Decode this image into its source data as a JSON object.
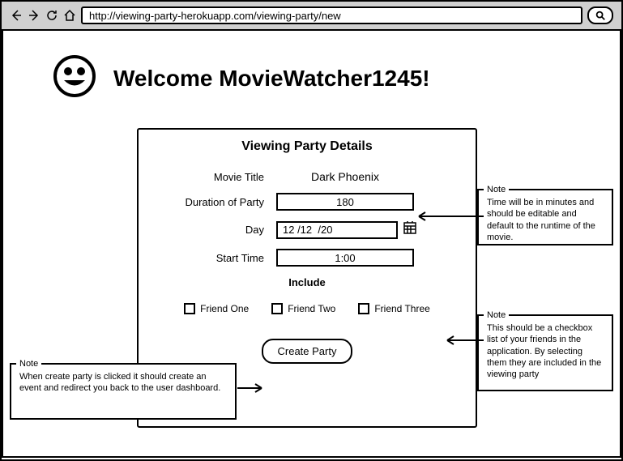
{
  "browser": {
    "url": "http://viewing-party-herokuapp.com/viewing-party/new"
  },
  "welcome": {
    "text": "Welcome MovieWatcher1245!"
  },
  "panel": {
    "title": "Viewing Party Details",
    "movie_title_label": "Movie Title",
    "movie_title_value": "Dark Phoenix",
    "duration_label": "Duration of Party",
    "duration_value": "180",
    "day_label": "Day",
    "day_value": "12 /12  /20",
    "start_time_label": "Start Time",
    "start_time_value": "1:00",
    "include_label": "Include",
    "create_button": "Create Party"
  },
  "friends": [
    "Friend One",
    "Friend Two",
    "Friend Three"
  ],
  "notes": {
    "legend": "Note",
    "duration": "Time will be in minutes and should be editable and default to the runtime of the movie.",
    "friends": "This should be a checkbox list of your friends in the application. By selecting them they are included in the viewing party",
    "create": "When create party is clicked it should create an event and redirect you back to the user dashboard."
  }
}
